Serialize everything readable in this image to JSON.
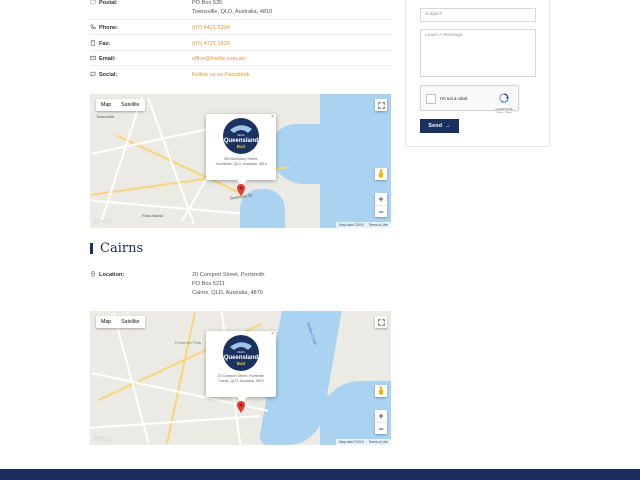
{
  "townsville": {
    "postal_label": "Postal:",
    "postal_lines": [
      "PO Box 535",
      "Townsville, QLD, Australia, 4810"
    ],
    "phone_label": "Phone:",
    "phone": "(07) 4421 5304",
    "fax_label": "Fax:",
    "fax": "(07) 4721 1520",
    "email_label": "Email:",
    "email": "office@fredie.com.au",
    "social_label": "Social:",
    "social": "Follow us on Facebook",
    "map": {
      "type_map": "Map",
      "type_satellite": "Satellite",
      "info_address_lines": [
        "553 Boundary Street,",
        "Townsville, QLD, Australia, 4810"
      ],
      "close": "×",
      "area_labels": [
        "Townsville",
        "Ross Island",
        "Boundary St"
      ],
      "google": "Google",
      "data": "Map data ©2019",
      "terms": "Terms of Use"
    }
  },
  "cairns": {
    "title": "Cairns",
    "location_label": "Location:",
    "location_lines": [
      "20 Comport Street, Portsmith",
      "PO Box 5211",
      "Cairns, QLD, Australia, 4870"
    ],
    "map": {
      "type_map": "Map",
      "type_satellite": "Satellite",
      "info_address_lines": [
        "20 Comport Street, Portsmith",
        "Cairns, QLD, Australia, 4870"
      ],
      "close": "×",
      "area_labels": [
        "Portsmith Park",
        "Smiths Creek"
      ],
      "google": "Google",
      "data": "Map data ©2019",
      "terms": "Terms of Use"
    }
  },
  "logo": {
    "line1": "North",
    "line2": "Queensland",
    "line3": "Bait"
  },
  "form": {
    "subject_placeholder": "Subject*",
    "message_placeholder": "Leave A Message",
    "recaptcha_label": "I'm not a robot",
    "recaptcha_brand": "reCAPTCHA",
    "recaptcha_privacy": "Privacy - Terms",
    "send_label": "Send"
  },
  "colors": {
    "accent": "#e8932b",
    "navy": "#1b3261",
    "water": "#aad3f1",
    "pin": "#e53935"
  }
}
